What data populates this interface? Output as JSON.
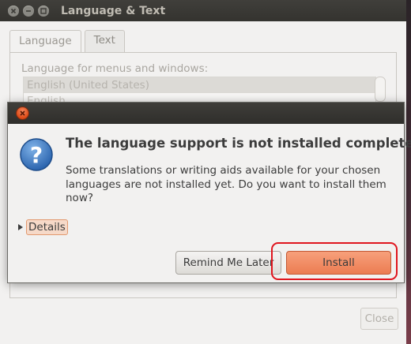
{
  "background_window": {
    "title": "Language & Text",
    "tabs": [
      {
        "label": "Language"
      },
      {
        "label": "Text"
      }
    ],
    "panel_label": "Language for menus and windows:",
    "languages": [
      "English (United States)",
      "English"
    ],
    "close_label": "Close"
  },
  "dialog": {
    "heading": "The language support is not installed completely",
    "body": "Some translations or writing aids available for your chosen languages are not installed yet. Do you want to install them now?",
    "details_label": "Details",
    "remind_label": "Remind Me Later",
    "install_label": "Install"
  },
  "colors": {
    "accent": "#ec7c52",
    "highlight": "#e0151e",
    "titlebar": "#3f3e3a"
  },
  "icons": {
    "dialog": "question-icon",
    "close": "close-icon"
  }
}
